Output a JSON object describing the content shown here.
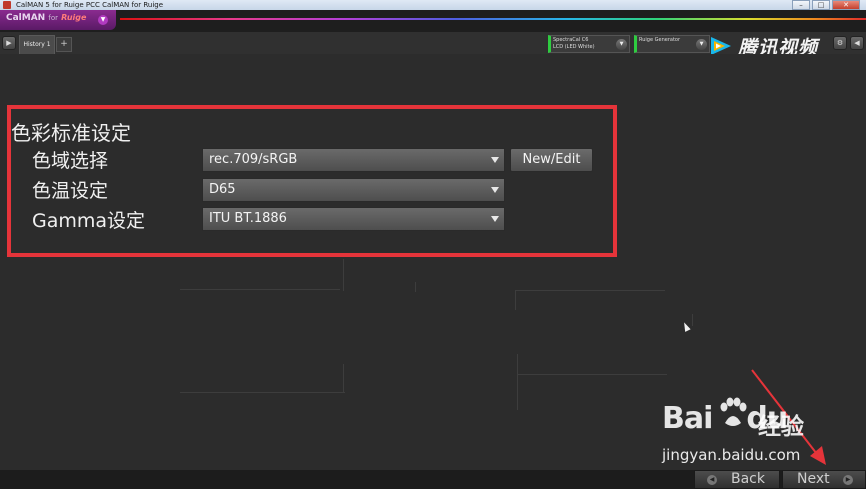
{
  "window": {
    "title": "CalMAN 5 for Ruige PCC CalMAN for Ruige",
    "controls": [
      "–",
      "□",
      "✕"
    ]
  },
  "brand": {
    "name": "CalMAN",
    "sub": "for",
    "maker": "Ruige"
  },
  "tabs": [
    {
      "label": "History 1"
    }
  ],
  "devices": [
    {
      "line1": "SpectraCal C6",
      "line2": "LCD (LED White)"
    },
    {
      "line1": "Ruige Generator",
      "line2": ""
    }
  ],
  "watermarks": {
    "tencent": "腾讯视频",
    "baidu_logo_left": "Bai",
    "baidu_logo_right": "du",
    "baidu_jingyan": "经验",
    "baidu_url": "jingyan.baidu.com"
  },
  "settings": {
    "section_title": "色彩标准设定",
    "rows": [
      {
        "label": "色域选择",
        "value": "rec.709/sRGB"
      },
      {
        "label": "色温设定",
        "value": "D65"
      },
      {
        "label": "Gamma设定",
        "value": "ITU BT.1886"
      }
    ],
    "new_edit_label": "New/Edit"
  },
  "footer": {
    "back_label": "Back",
    "next_label": "Next"
  },
  "colors": {
    "highlight": "#e5343a",
    "brand": "#7a2582",
    "device_indicator": "#2ecc40"
  }
}
